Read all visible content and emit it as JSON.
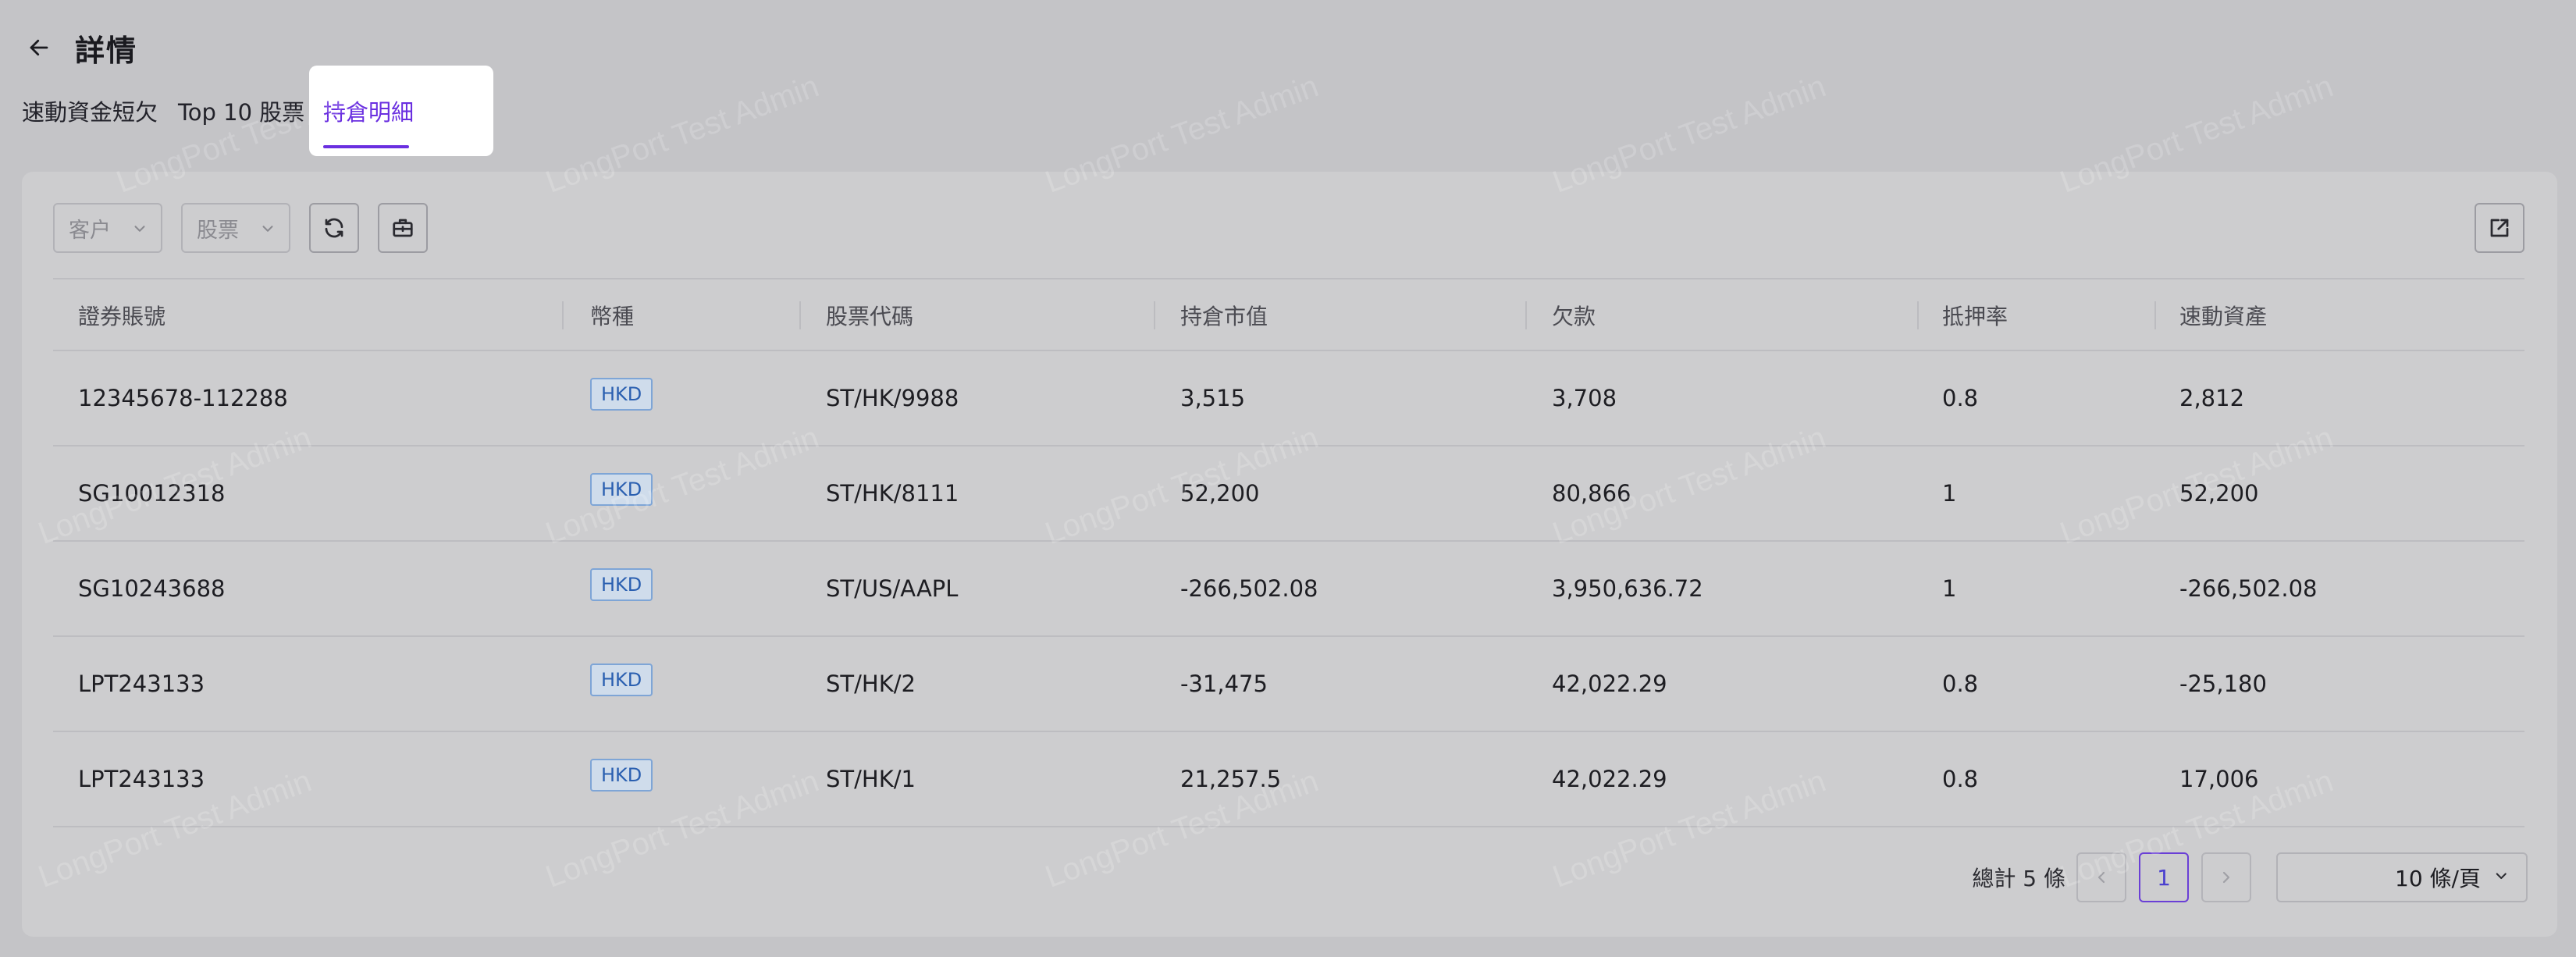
{
  "header": {
    "title": "詳情"
  },
  "tabs": [
    {
      "label": "速動資金短欠"
    },
    {
      "label": "Top 10 股票"
    },
    {
      "label": "持倉明細"
    }
  ],
  "active_tab": "持倉明細",
  "filters": {
    "client_placeholder": "客户",
    "stock_placeholder": "股票"
  },
  "table": {
    "columns": [
      "證券賬號",
      "幣種",
      "股票代碼",
      "持倉市值",
      "欠款",
      "抵押率",
      "速動資產"
    ],
    "rows": [
      [
        "12345678-112288",
        "HKD",
        "ST/HK/9988",
        "3,515",
        "3,708",
        "0.8",
        "2,812"
      ],
      [
        "SG10012318",
        "HKD",
        "ST/HK/8111",
        "52,200",
        "80,866",
        "1",
        "52,200"
      ],
      [
        "SG10243688",
        "HKD",
        "ST/US/AAPL",
        "-266,502.08",
        "3,950,636.72",
        "1",
        "-266,502.08"
      ],
      [
        "LPT243133",
        "HKD",
        "ST/HK/2",
        "-31,475",
        "42,022.29",
        "0.8",
        "-25,180"
      ],
      [
        "LPT243133",
        "HKD",
        "ST/HK/1",
        "21,257.5",
        "42,022.29",
        "0.8",
        "17,006"
      ]
    ]
  },
  "pagination": {
    "total_label": "總計 5 條",
    "current_page": "1",
    "page_size_label": "10 條/頁"
  },
  "watermark": "LongPort Test Admin",
  "colors": {
    "accent": "#6a2fe0",
    "badge_text": "#2a5fb0",
    "badge_border": "#7ea5d6",
    "badge_bg": "#cfdceb"
  }
}
